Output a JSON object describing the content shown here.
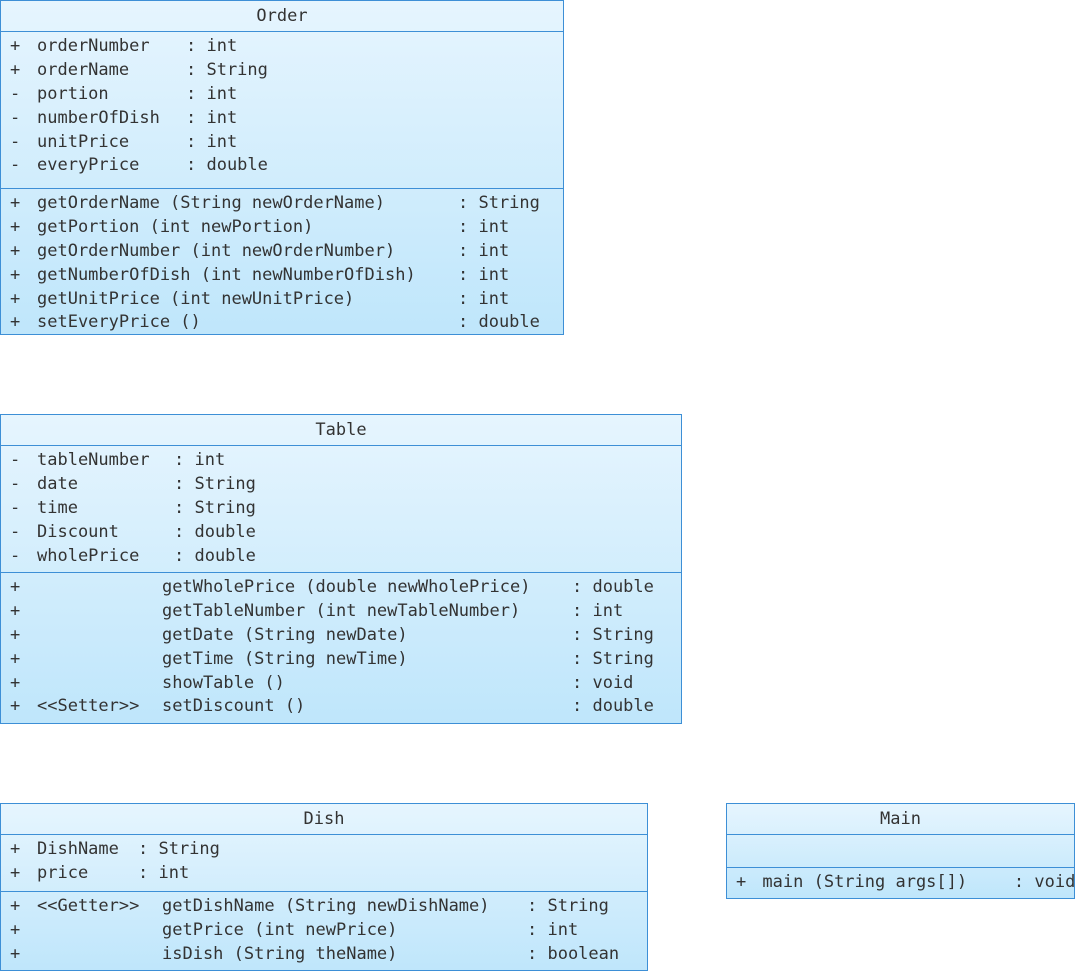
{
  "classes": {
    "order": {
      "name": "Order",
      "attributes": [
        {
          "vis": "+",
          "name": "orderNumber",
          "type": ": int"
        },
        {
          "vis": "+",
          "name": "orderName",
          "type": ": String"
        },
        {
          "vis": "-",
          "name": "portion",
          "type": ": int"
        },
        {
          "vis": "-",
          "name": "numberOfDish",
          "type": ": int"
        },
        {
          "vis": "-",
          "name": "unitPrice",
          "type": ": int"
        },
        {
          "vis": "-",
          "name": "everyPrice",
          "type": ": double"
        }
      ],
      "operations": [
        {
          "vis": "+",
          "stereo": "",
          "name": "getOrderName (String newOrderName)",
          "type": ": String"
        },
        {
          "vis": "+",
          "stereo": "",
          "name": "getPortion (int newPortion)",
          "type": ": int"
        },
        {
          "vis": "+",
          "stereo": "",
          "name": "getOrderNumber (int newOrderNumber)",
          "type": ": int"
        },
        {
          "vis": "+",
          "stereo": "",
          "name": "getNumberOfDish (int newNumberOfDish)",
          "type": ": int"
        },
        {
          "vis": "+",
          "stereo": "",
          "name": "getUnitPrice (int newUnitPrice)",
          "type": ": int"
        },
        {
          "vis": "+",
          "stereo": "",
          "name": "setEveryPrice ()",
          "type": ": double"
        }
      ]
    },
    "table": {
      "name": "Table",
      "attributes": [
        {
          "vis": "-",
          "name": "tableNumber",
          "type": ": int"
        },
        {
          "vis": "-",
          "name": "date",
          "type": ": String"
        },
        {
          "vis": "-",
          "name": "time",
          "type": ": String"
        },
        {
          "vis": "-",
          "name": "Discount",
          "type": ": double"
        },
        {
          "vis": "-",
          "name": "wholePrice",
          "type": ": double"
        }
      ],
      "operations": [
        {
          "vis": "+",
          "stereo": "",
          "name": "getWholePrice (double newWholePrice)",
          "type": ": double"
        },
        {
          "vis": "+",
          "stereo": "",
          "name": "getTableNumber (int newTableNumber)",
          "type": ": int"
        },
        {
          "vis": "+",
          "stereo": "",
          "name": "getDate (String newDate)",
          "type": ": String"
        },
        {
          "vis": "+",
          "stereo": "",
          "name": "getTime (String newTime)",
          "type": ": String"
        },
        {
          "vis": "+",
          "stereo": "",
          "name": "showTable ()",
          "type": ": void"
        },
        {
          "vis": "+",
          "stereo": "<<Setter>>",
          "name": "setDiscount ()",
          "type": ": double"
        }
      ]
    },
    "dish": {
      "name": "Dish",
      "attributes": [
        {
          "vis": "+",
          "name": "DishName",
          "type": ": String"
        },
        {
          "vis": "+",
          "name": "price",
          "type": ": int"
        }
      ],
      "operations": [
        {
          "vis": "+",
          "stereo": "<<Getter>>",
          "name": "getDishName (String newDishName)",
          "type": ": String"
        },
        {
          "vis": "+",
          "stereo": "",
          "name": "getPrice (int newPrice)",
          "type": ": int"
        },
        {
          "vis": "+",
          "stereo": "",
          "name": "isDish (String theName)",
          "type": ": boolean"
        }
      ]
    },
    "main": {
      "name": "Main",
      "attributes": [],
      "operations": [
        {
          "vis": "+",
          "stereo": "",
          "name": "main (String args[])",
          "type": ": void"
        }
      ]
    }
  }
}
